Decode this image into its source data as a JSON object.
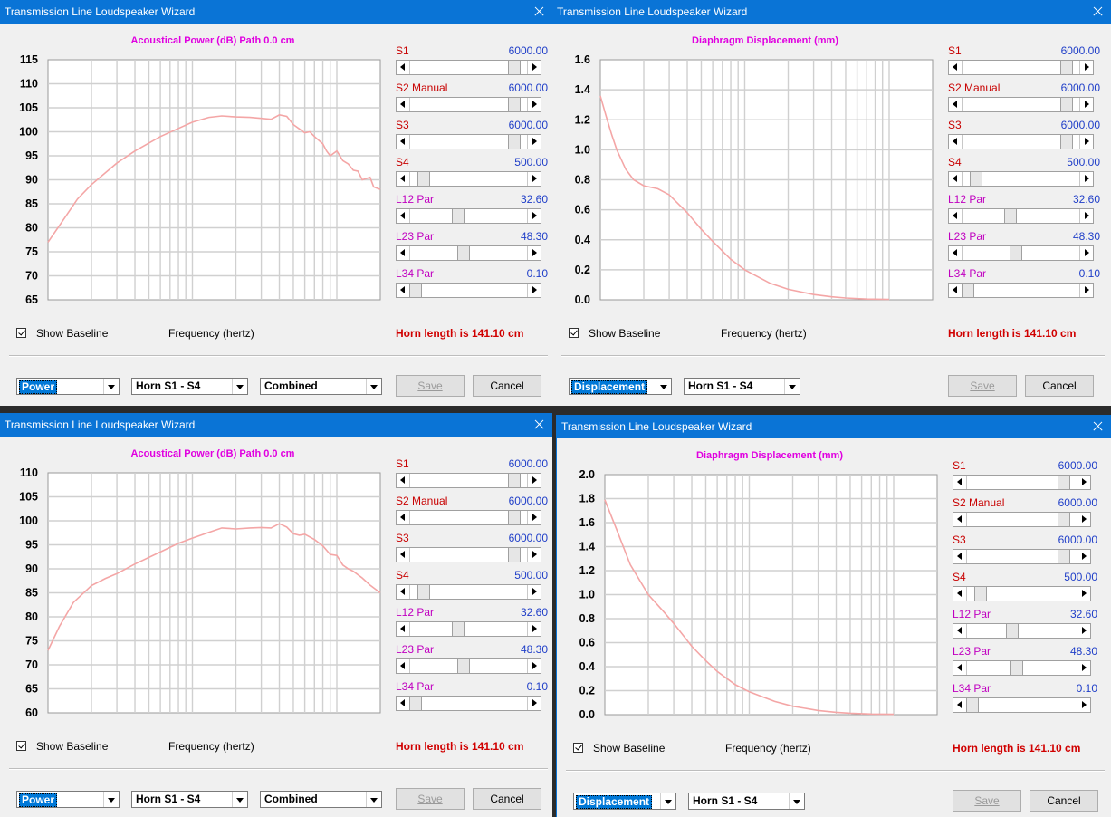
{
  "colors": {
    "title_bar": "#0a74d6",
    "chart_title": "#e000e0",
    "curve": "#f4a6a6",
    "grid": "#d0d0d0",
    "slider_value": "#1f3ec8",
    "label_red": "#c80000",
    "label_magenta": "#c000c0",
    "horn_text": "#d00000"
  },
  "windows": [
    {
      "title": "Transmission Line Loudspeaker Wizard",
      "chart_title": "Acoustical Power (dB)   Path 0.0 cm",
      "show_baseline": "Show Baseline",
      "freq_label": "Frequency (hertz)",
      "horn_length": "Horn length is 141.10 cm",
      "combo_type": "Power",
      "combo_horn": "Horn S1 - S4",
      "combo_mode": "Combined",
      "save": "Save",
      "cancel": "Cancel",
      "sliders": [
        {
          "label": "S1",
          "value": "6000.00",
          "pos": 0.93
        },
        {
          "label": "S2  Manual",
          "value": "6000.00",
          "pos": 0.93
        },
        {
          "label": "S3",
          "value": "6000.00",
          "pos": 0.93
        },
        {
          "label": "S4",
          "value": "500.00",
          "pos": 0.08
        },
        {
          "label": "L12  Par",
          "value": "32.60",
          "pos": 0.4
        },
        {
          "label": "L23  Par",
          "value": "48.30",
          "pos": 0.45
        },
        {
          "label": "L34  Par",
          "value": "0.10",
          "pos": 0.0
        }
      ],
      "chart_data": {
        "type": "line",
        "xscale": "log",
        "xlim": [
          10,
          2000
        ],
        "x_ticks": [
          "10",
          "2",
          "4",
          "6",
          "8",
          "100",
          "2",
          "4",
          "6",
          "8",
          "1000",
          "2"
        ],
        "ylim": [
          65,
          115
        ],
        "y_ticks": [
          "115",
          "110",
          "105",
          "100",
          "95",
          "90",
          "85",
          "80",
          "75",
          "70",
          "65"
        ],
        "grid": true,
        "series": [
          {
            "x": [
              10,
              13,
              16,
              20,
              30,
              40,
              60,
              80,
              100,
              130,
              160,
              200,
              250,
              300,
              350,
              400,
              450,
              500,
              550,
              600,
              650,
              700,
              800,
              850,
              900,
              1000,
              1100,
              1200,
              1300,
              1400,
              1500,
              1700,
              1800,
              2000
            ],
            "y": [
              77,
              82,
              86,
              89,
              93.5,
              96,
              99,
              100.7,
              102,
              103,
              103.3,
              103.1,
              103,
              102.8,
              102.6,
              103.5,
              103.2,
              101.5,
              100.6,
              99.8,
              100,
              99,
              97.5,
              96,
              95,
              96,
              94,
              93.3,
              92,
              91.8,
              90,
              90.5,
              88.5,
              88
            ]
          }
        ]
      }
    },
    {
      "title": "Transmission Line Loudspeaker Wizard",
      "chart_title": "Diaphragm Displacement (mm)",
      "show_baseline": "Show Baseline",
      "freq_label": "Frequency (hertz)",
      "horn_length": "Horn length is 141.10 cm",
      "combo_type": "Displacement",
      "combo_horn": "Horn S1 - S4",
      "save": "Save",
      "cancel": "Cancel",
      "sliders": [
        {
          "label": "S1",
          "value": "6000.00",
          "pos": 0.93
        },
        {
          "label": "S2  Manual",
          "value": "6000.00",
          "pos": 0.93
        },
        {
          "label": "S3",
          "value": "6000.00",
          "pos": 0.93
        },
        {
          "label": "S4",
          "value": "500.00",
          "pos": 0.08
        },
        {
          "label": "L12  Par",
          "value": "32.60",
          "pos": 0.4
        },
        {
          "label": "L23  Par",
          "value": "48.30",
          "pos": 0.45
        },
        {
          "label": "L34  Par",
          "value": "0.10",
          "pos": 0.0
        }
      ],
      "chart_data": {
        "type": "line",
        "xscale": "log",
        "xlim": [
          10,
          2000
        ],
        "x_ticks": [
          "10",
          "2",
          "4",
          "6",
          "8",
          "100",
          "2",
          "4",
          "6",
          "8",
          "1000",
          "2"
        ],
        "ylim": [
          0,
          1.6
        ],
        "y_ticks": [
          "1.6",
          "1.4",
          "1.2",
          "1.0",
          "0.8",
          "0.6",
          "0.4",
          "0.2",
          "0.0"
        ],
        "grid": true,
        "series": [
          {
            "x": [
              10,
              11,
              12,
              13,
              15,
              17,
              20,
              25,
              30,
              40,
              50,
              60,
              80,
              100,
              150,
              200,
              300,
              400,
              500,
              700,
              1000
            ],
            "y": [
              1.36,
              1.22,
              1.1,
              1.0,
              0.87,
              0.8,
              0.76,
              0.74,
              0.7,
              0.58,
              0.47,
              0.39,
              0.27,
              0.2,
              0.11,
              0.07,
              0.035,
              0.02,
              0.012,
              0.005,
              0.003
            ]
          }
        ]
      }
    },
    {
      "title": "Transmission Line Loudspeaker Wizard",
      "chart_title": "Acoustical Power (dB)   Path 0.0 cm",
      "show_baseline": "Show Baseline",
      "freq_label": "Frequency (hertz)",
      "horn_length": "Horn length is 141.10 cm",
      "combo_type": "Power",
      "combo_horn": "Horn S1 - S4",
      "combo_mode": "Combined",
      "save": "Save",
      "cancel": "Cancel",
      "sliders": [
        {
          "label": "S1",
          "value": "6000.00",
          "pos": 0.93
        },
        {
          "label": "S2  Manual",
          "value": "6000.00",
          "pos": 0.93
        },
        {
          "label": "S3",
          "value": "6000.00",
          "pos": 0.93
        },
        {
          "label": "S4",
          "value": "500.00",
          "pos": 0.08
        },
        {
          "label": "L12  Par",
          "value": "32.60",
          "pos": 0.4
        },
        {
          "label": "L23  Par",
          "value": "48.30",
          "pos": 0.45
        },
        {
          "label": "L34  Par",
          "value": "0.10",
          "pos": 0.0
        }
      ],
      "chart_data": {
        "type": "line",
        "xscale": "log",
        "xlim": [
          10,
          2000
        ],
        "x_ticks": [
          "10",
          "2",
          "4",
          "6",
          "8",
          "100",
          "2",
          "4",
          "6",
          "8",
          "1000",
          "2"
        ],
        "ylim": [
          60,
          110
        ],
        "y_ticks": [
          "110",
          "105",
          "100",
          "95",
          "90",
          "85",
          "80",
          "75",
          "70",
          "65",
          "60"
        ],
        "grid": true,
        "series": [
          {
            "x": [
              10,
              12,
              15,
              20,
              25,
              30,
              40,
              60,
              80,
              100,
              130,
              160,
              200,
              250,
              300,
              350,
              400,
              450,
              500,
              550,
              600,
              700,
              800,
              900,
              1000,
              1100,
              1200,
              1300,
              1500,
              1700,
              2000
            ],
            "y": [
              73,
              78,
              83,
              86.5,
              88,
              89,
              91,
              93.5,
              95.3,
              96.4,
              97.6,
              98.5,
              98.3,
              98.5,
              98.6,
              98.5,
              99.4,
              98.7,
              97.3,
              97,
              97.2,
              96.1,
              94.8,
              93,
              92.8,
              90.8,
              90,
              89.5,
              88.1,
              86.6,
              85
            ]
          }
        ]
      }
    },
    {
      "title": "Transmission Line Loudspeaker Wizard",
      "chart_title": "Diaphragm Displacement (mm)",
      "show_baseline": "Show Baseline",
      "freq_label": "Frequency (hertz)",
      "horn_length": "Horn length is 141.10 cm",
      "combo_type": "Displacement",
      "combo_horn": "Horn S1 - S4",
      "save": "Save",
      "cancel": "Cancel",
      "sliders": [
        {
          "label": "S1",
          "value": "6000.00",
          "pos": 0.93
        },
        {
          "label": "S2  Manual",
          "value": "6000.00",
          "pos": 0.93
        },
        {
          "label": "S3",
          "value": "6000.00",
          "pos": 0.93
        },
        {
          "label": "S4",
          "value": "500.00",
          "pos": 0.08
        },
        {
          "label": "L12  Par",
          "value": "32.60",
          "pos": 0.4
        },
        {
          "label": "L23  Par",
          "value": "48.30",
          "pos": 0.45
        },
        {
          "label": "L34  Par",
          "value": "0.10",
          "pos": 0.0
        }
      ],
      "chart_data": {
        "type": "line",
        "xscale": "log",
        "xlim": [
          10,
          2000
        ],
        "x_ticks": [
          "10",
          "2",
          "4",
          "6",
          "8",
          "100",
          "2",
          "4",
          "6",
          "8",
          "1000",
          "2"
        ],
        "ylim": [
          0,
          2.0
        ],
        "y_ticks": [
          "2.0",
          "1.8",
          "1.6",
          "1.4",
          "1.2",
          "1.0",
          "0.8",
          "0.6",
          "0.4",
          "0.2",
          "0.0"
        ],
        "grid": true,
        "series": [
          {
            "x": [
              10,
              12,
              15,
              20,
              25,
              30,
              40,
              50,
              60,
              80,
              100,
              150,
              200,
              300,
              400,
              500,
              700,
              1000
            ],
            "y": [
              1.79,
              1.55,
              1.25,
              1.0,
              0.87,
              0.76,
              0.57,
              0.45,
              0.36,
              0.25,
              0.19,
              0.11,
              0.07,
              0.035,
              0.02,
              0.012,
              0.005,
              0.003
            ]
          }
        ]
      }
    }
  ]
}
